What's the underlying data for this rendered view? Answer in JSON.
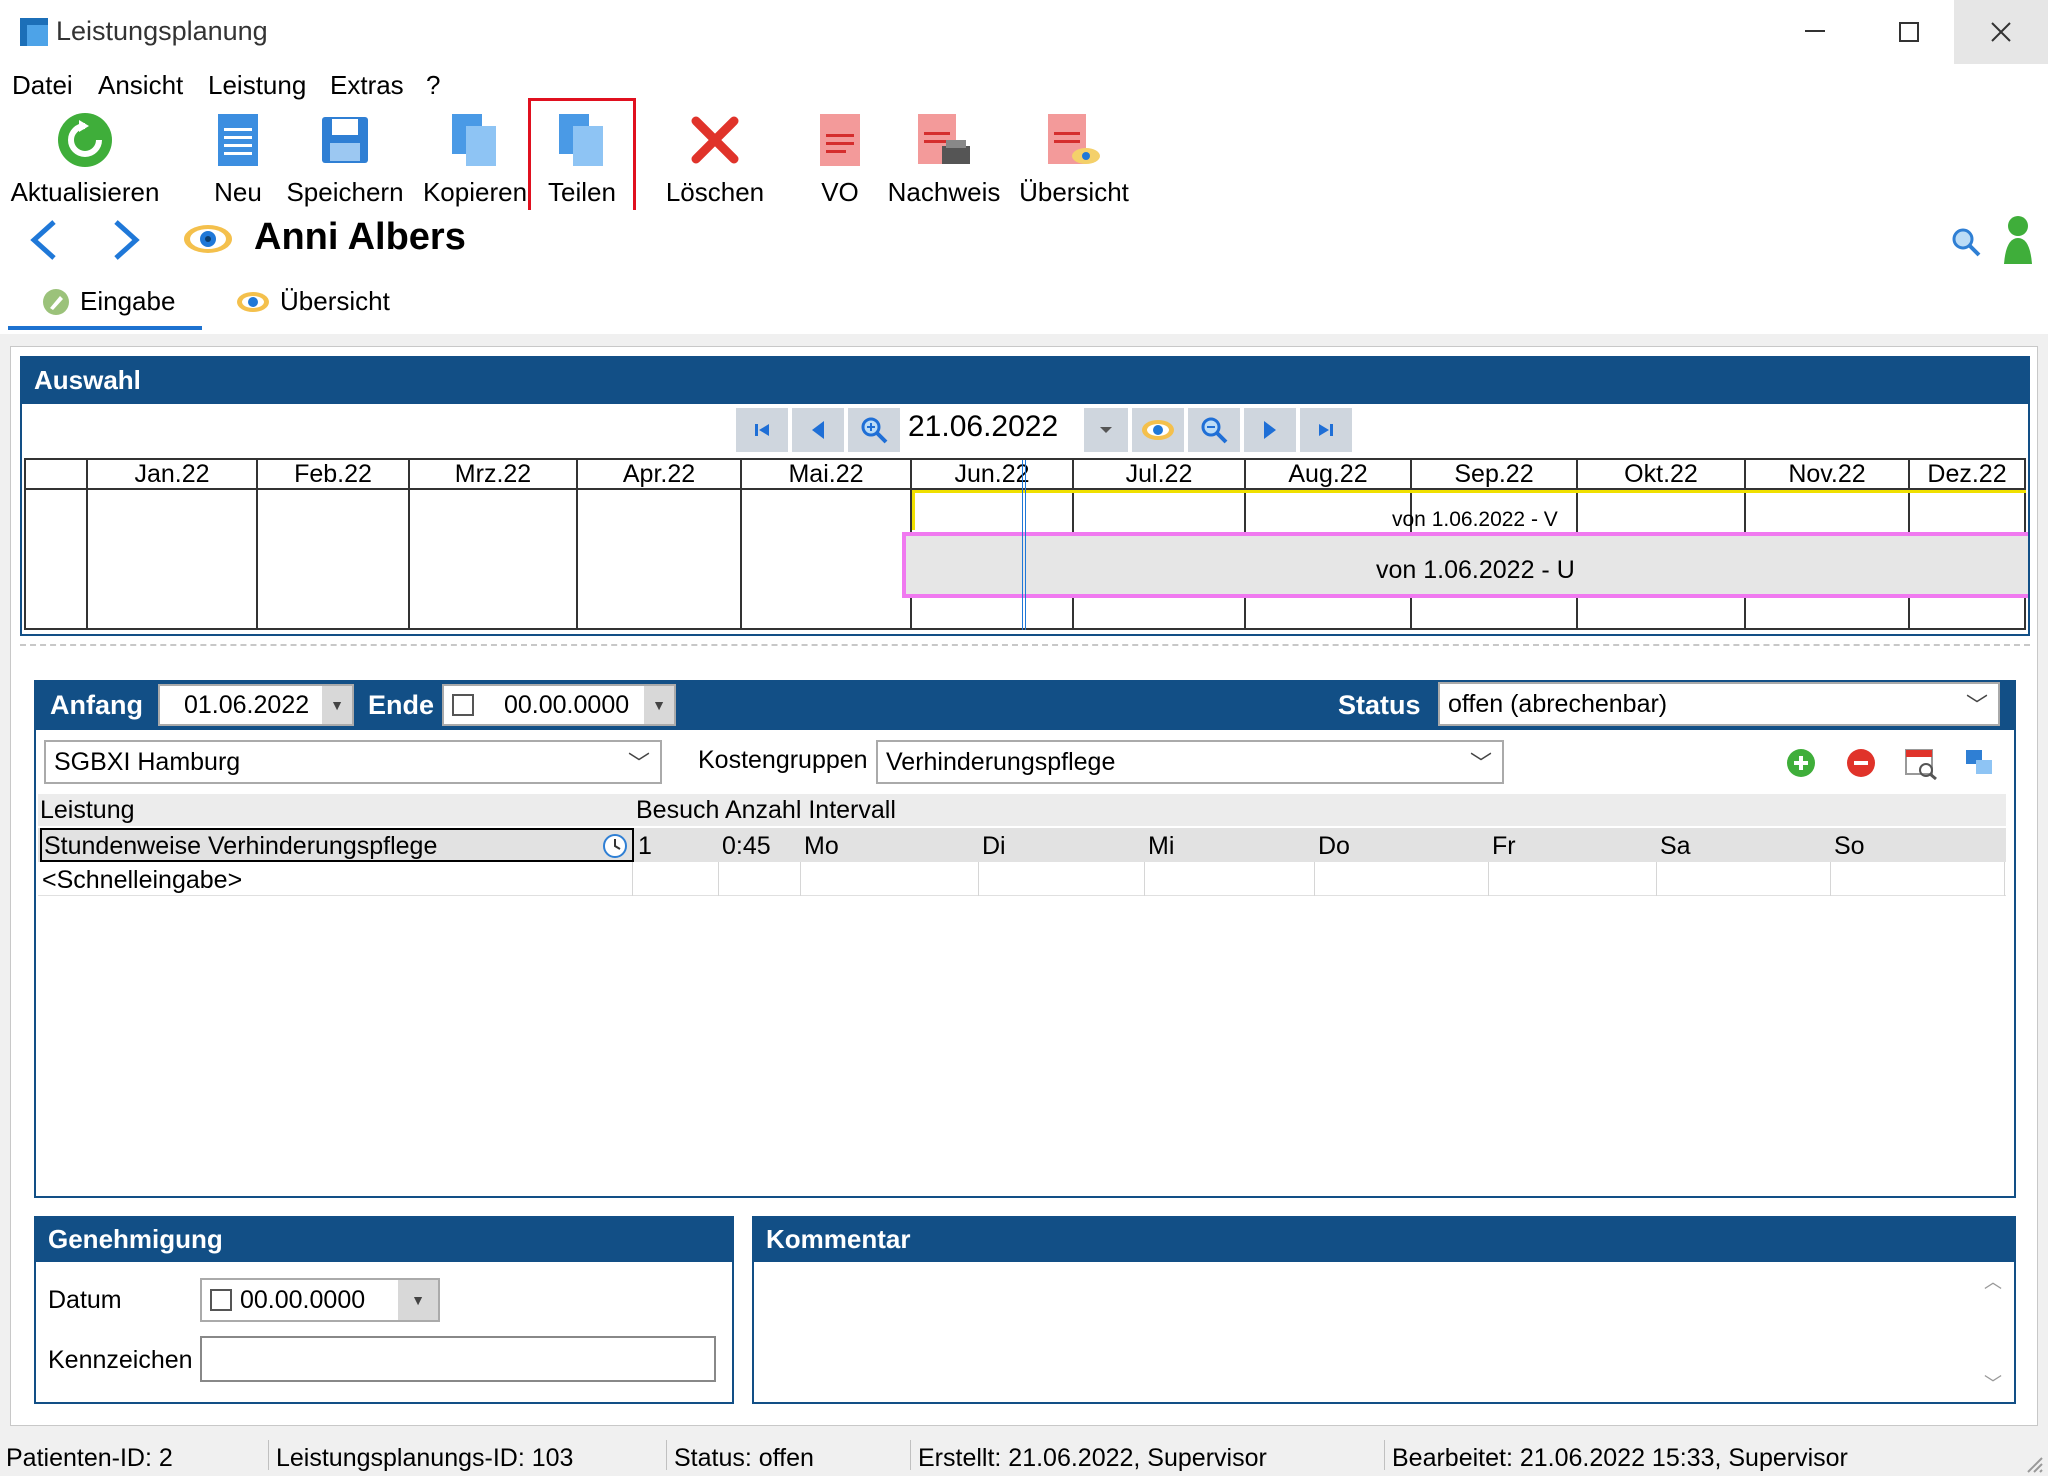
{
  "window": {
    "title": "Leistungsplanung"
  },
  "menu": [
    "Datei",
    "Ansicht",
    "Leistung",
    "Extras",
    "?"
  ],
  "toolbar": {
    "aktualisieren": "Aktualisieren",
    "neu": "Neu",
    "speichern": "Speichern",
    "kopieren": "Kopieren",
    "teilen": "Teilen",
    "loeschen": "Löschen",
    "vo": "VO",
    "nachweis": "Nachweis",
    "uebersicht": "Übersicht"
  },
  "patient": {
    "name": "Anni Albers"
  },
  "tabs": {
    "eingabe": "Eingabe",
    "uebersicht": "Übersicht"
  },
  "auswahl": {
    "title": "Auswahl",
    "date": "21.06.2022",
    "months": [
      "Jan.22",
      "Feb.22",
      "Mrz.22",
      "Apr.22",
      "Mai.22",
      "Jun.22",
      "Jul.22",
      "Aug.22",
      "Sep.22",
      "Okt.22",
      "Nov.22",
      "Dez.22"
    ],
    "bar_v": "von 1.06.2022 - V",
    "bar_u": "von 1.06.2022 - U"
  },
  "form": {
    "anfang_label": "Anfang",
    "anfang_value": "01.06.2022",
    "ende_label": "Ende",
    "ende_value": "00.00.0000",
    "status_label": "Status",
    "status_value": "offen (abrechenbar)",
    "traeger_value": "SGBXI Hamburg",
    "kostengruppen_label": "Kostengruppen",
    "kostengruppen_value": "Verhinderungspflege"
  },
  "grid": {
    "header_leistung": "Leistung",
    "header_besuch": "Besuch Anzahl Intervall",
    "row1": {
      "leistung": "Stundenweise Verhinderungspflege",
      "besuch": "1",
      "intervall": "0:45",
      "days": [
        "Mo",
        "Di",
        "Mi",
        "Do",
        "Fr",
        "Sa",
        "So"
      ]
    },
    "row2": {
      "leistung": "<Schnelleingabe>"
    }
  },
  "genehmigung": {
    "title": "Genehmigung",
    "datum_label": "Datum",
    "datum_value": "00.00.0000",
    "kennzeichen_label": "Kennzeichen"
  },
  "kommentar": {
    "title": "Kommentar"
  },
  "statusbar": {
    "patient_id": "Patienten-ID: 2",
    "leistungsplanung_id": "Leistungsplanungs-ID: 103",
    "status": "Status: offen",
    "erstellt": "Erstellt: 21.06.2022, Supervisor",
    "bearbeitet": "Bearbeitet: 21.06.2022 15:33, Supervisor"
  },
  "colors": {
    "header_blue": "#124f86",
    "highlight_red": "#e0101f",
    "bar_v_yellow": "#f0e000",
    "bar_u_pink": "#f079f0"
  }
}
